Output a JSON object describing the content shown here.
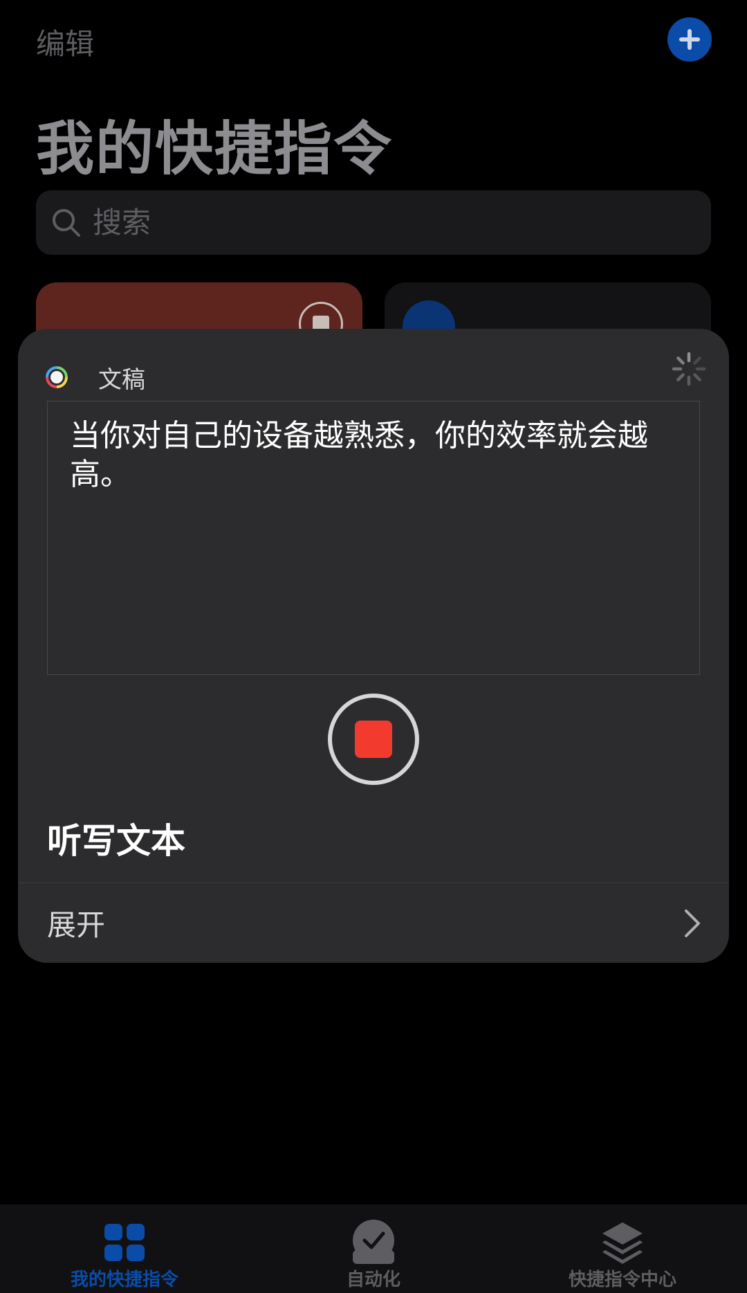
{
  "header": {
    "edit_label": "编辑",
    "title": "我的快捷指令"
  },
  "search": {
    "placeholder": "搜索"
  },
  "card": {
    "app_name": "文稿",
    "transcript": "当你对自己的设备越熟悉，你的效率就会越高。",
    "action_title": "听写文本",
    "expand_label": "展开"
  },
  "tabs": [
    {
      "label": "我的快捷指令",
      "icon": "grid-icon",
      "active": true
    },
    {
      "label": "自动化",
      "icon": "automation-check-icon",
      "active": false
    },
    {
      "label": "快捷指令中心",
      "icon": "gallery-layers-icon",
      "active": false
    }
  ],
  "colors": {
    "accent": "#0a4ca8",
    "record_red": "#f23a2f",
    "card_bg": "#2c2c2e",
    "shortcut_tile_red": "#5d251d"
  }
}
